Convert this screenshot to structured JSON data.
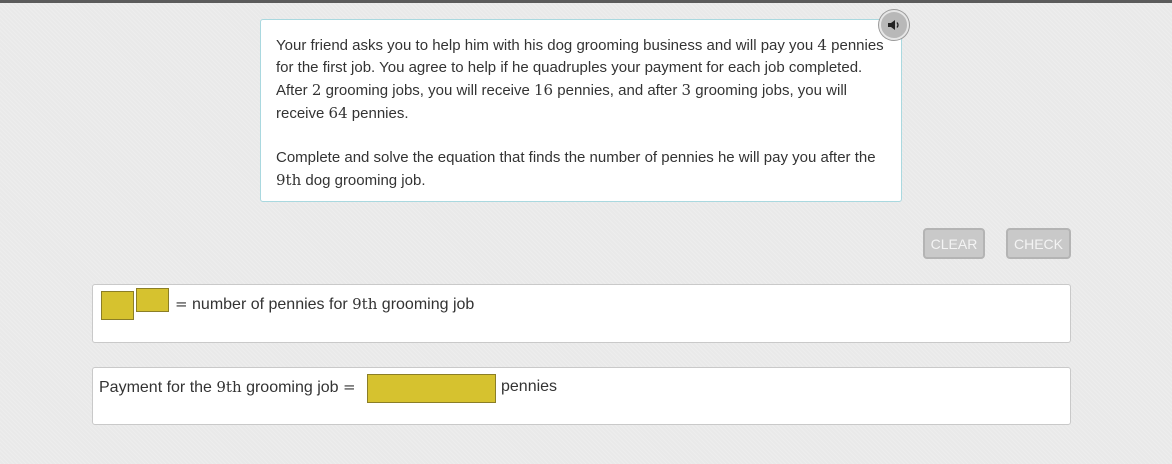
{
  "problem": {
    "p1_a": "Your friend asks you to help him with his dog grooming business and will pay you ",
    "p1_n1": "4",
    "p1_b": " pennies for the first job. You agree to help if he quadruples your payment for each job completed. After ",
    "p1_n2": "2",
    "p1_c": " grooming jobs, you will receive ",
    "p1_n3": "16",
    "p1_d": " pennies, and after ",
    "p1_n4": "3",
    "p1_e": " grooming jobs, you will receive ",
    "p1_n5": "64",
    "p1_f": " pennies.",
    "p2_a": "Complete and solve the equation that finds the number of pennies he will pay you after the ",
    "p2_n1": "9th",
    "p2_b": " dog grooming job."
  },
  "audio": {
    "icon": "speaker-icon"
  },
  "buttons": {
    "clear_label": "CLEAR",
    "check_label": "CHECK"
  },
  "equation": {
    "equals": "=",
    "rhs_a": " number of pennies for ",
    "rhs_n": "9th",
    "rhs_b": " grooming job"
  },
  "answer": {
    "label_a": "Payment for the ",
    "label_n": "9th",
    "label_b": " grooming job ",
    "equals": "=",
    "unit": "pennies"
  },
  "colors": {
    "slot_fill": "#d6c22f",
    "slot_border": "#8b7e26",
    "problem_border": "#a9d8df"
  }
}
